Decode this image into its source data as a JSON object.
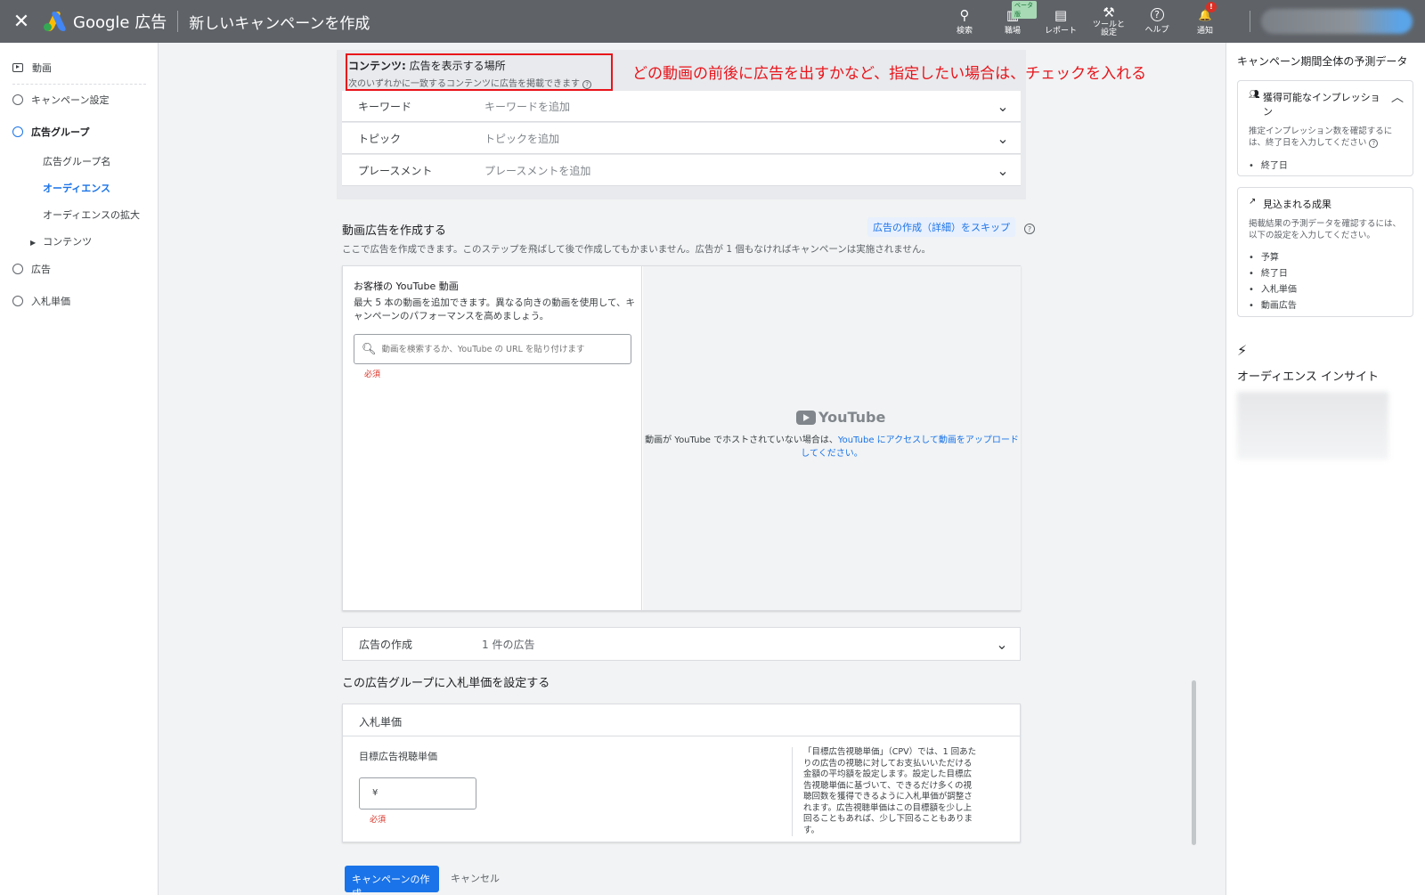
{
  "topbar": {
    "close_glyph": "✕",
    "brand": "Google 広告",
    "page_title": "新しいキャンペーンを作成",
    "icons": [
      {
        "label": "検索",
        "glyph": "⚲",
        "icon": "search-icon"
      },
      {
        "label": "職場",
        "glyph": "▥",
        "icon": "workspace-icon",
        "badge": "ベータ版"
      },
      {
        "label": "レポート",
        "glyph": "▤",
        "icon": "report-icon"
      },
      {
        "label": "ツールと\n設定",
        "glyph": "⚒",
        "icon": "wrench-icon"
      },
      {
        "label": "ヘルプ",
        "glyph": "?",
        "icon": "help-icon"
      },
      {
        "label": "通知",
        "glyph": "🔔",
        "icon": "bell-icon",
        "badge": "!"
      }
    ]
  },
  "leftnav": {
    "video": "動画",
    "campaign_settings": "キャンペーン設定",
    "ad_group": "広告グループ",
    "ad_group_name": "広告グループ名",
    "audience": "オーディエンス",
    "audience_expansion": "オーディエンスの拡大",
    "content": "コンテンツ",
    "ads": "広告",
    "bidding": "入札単価"
  },
  "content_section": {
    "title_bold": "コンテンツ:",
    "title_rest": " 広告を表示する場所",
    "subtitle": "次のいずれかに一致するコンテンツに広告を掲載できます",
    "annotation": "どの動画の前後に広告を出すかなど、指定したい場合は、チェックを入れる",
    "rows": [
      {
        "key": "キーワード",
        "placeholder": "キーワードを追加"
      },
      {
        "key": "トピック",
        "placeholder": "トピックを追加"
      },
      {
        "key": "プレースメント",
        "placeholder": "プレースメントを追加"
      }
    ]
  },
  "video_ad": {
    "title": "動画広告を作成する",
    "skip_link": "広告の作成（詳細）をスキップ",
    "description": "ここで広告を作成できます。このステップを飛ばして後で作成してもかまいません。広告が 1 個もなければキャンペーンは実施されません。",
    "your_videos_heading": "お客様の YouTube 動画",
    "your_videos_desc": "最大 5 本の動画を追加できます。異なる向きの動画を使用して、キャンペーンのパフォーマンスを高めましょう。",
    "search_placeholder": "動画を検索するか、YouTube の URL を貼り付けます",
    "required": "必須",
    "yt_logo": "YouTube",
    "yt_msg_prefix": "動画が YouTube でホストされていない場合は、",
    "yt_msg_link": "YouTube にアクセスして動画をアップロードしてください。"
  },
  "ad_creation": {
    "key": "広告の作成",
    "value": "1 件の広告"
  },
  "bid": {
    "section_title": "この広告グループに入札単価を設定する",
    "card_header": "入札単価",
    "field_label": "目標広告視聴単価",
    "currency": "¥",
    "required": "必須",
    "help": "「目標広告視聴単価」（CPV）では、1 回あたりの広告の視聴に対してお支払いいただける金額の平均額を設定します。設定した目標広告視聴単価に基づいて、できるだけ多くの視聴回数を獲得できるように入札単価が調整されます。広告視聴単価はこの目標額を少し上回ることもあれば、少し下回ることもあります。"
  },
  "buttons": {
    "create": "キャンペーンの作成",
    "cancel": "キャンセル"
  },
  "rightpanel": {
    "title": "キャンペーン期間全体の予測データ",
    "impressions_title": "獲得可能なインプレッション",
    "impressions_desc": "推定インプレッション数を確認するには、終了日を入力してください",
    "impressions_items": [
      "終了日"
    ],
    "results_title": "見込まれる成果",
    "results_desc": "掲載結果の予測データを確認するには、以下の設定を入力してください。",
    "results_items": [
      "予算",
      "終了日",
      "入札単価",
      "動画広告"
    ],
    "insight_title": "オーディエンス インサイト"
  }
}
